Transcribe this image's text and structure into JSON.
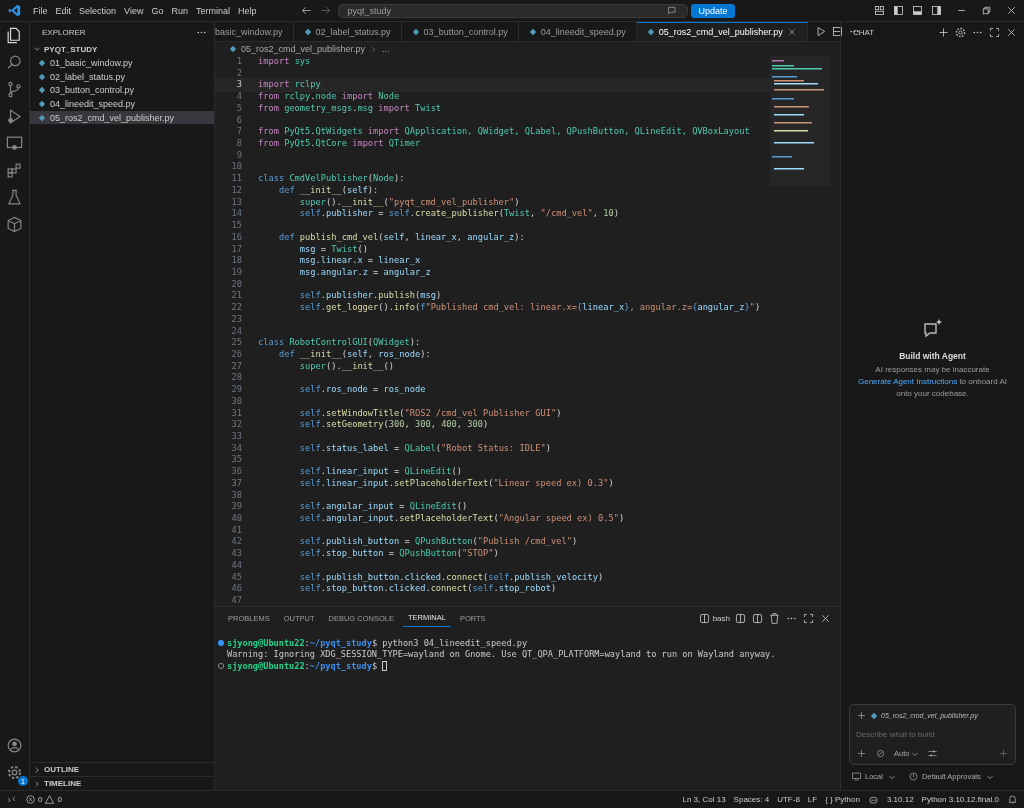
{
  "title_bar": {
    "menu": [
      "File",
      "Edit",
      "Selection",
      "View",
      "Go",
      "Run",
      "Terminal",
      "Help"
    ],
    "search": "pyqt_study",
    "update_button": "Update"
  },
  "activity_bar": {
    "badge": "1"
  },
  "explorer": {
    "title": "EXPLORER",
    "folder": {
      "name": "PYQT_STUDY",
      "expanded": true,
      "files": [
        {
          "name": "01_basic_window.py",
          "selected": false
        },
        {
          "name": "02_label_status.py",
          "selected": false
        },
        {
          "name": "03_button_control.py",
          "selected": false
        },
        {
          "name": "04_lineedit_speed.py",
          "selected": false
        },
        {
          "name": "05_ros2_cmd_vel_publisher.py",
          "selected": true
        }
      ]
    },
    "sections": [
      {
        "name": "OUTLINE",
        "expanded": false
      },
      {
        "name": "TIMELINE",
        "expanded": false
      }
    ]
  },
  "tabs": [
    {
      "label": "basic_window.py",
      "selected": false,
      "kind": "cut"
    },
    {
      "label": "02_label_status.py",
      "selected": false,
      "kind": "file"
    },
    {
      "label": "03_button_control.py",
      "selected": false,
      "kind": "file"
    },
    {
      "label": "04_lineedit_speed.py",
      "selected": false,
      "kind": "file"
    },
    {
      "label": "05_ros2_cmd_vel_publisher.py",
      "selected": true,
      "kind": "file"
    }
  ],
  "breadcrumb": {
    "file": "05_ros2_cmd_vel_publisher.py",
    "more": "..."
  },
  "editor": {
    "lines": [
      {
        "no": "1",
        "current": false,
        "tokens": [
          {
            "text": "import ",
            "kind": "keyword"
          },
          {
            "text": "sys",
            "kind": "type"
          }
        ]
      },
      {
        "no": "2",
        "current": false
      },
      {
        "no": "3",
        "current": true,
        "tokens": [
          {
            "text": "import ",
            "kind": "keyword"
          },
          {
            "text": "rclpy",
            "kind": "type"
          }
        ]
      },
      {
        "no": "4",
        "current": false,
        "tokens": [
          {
            "text": "from ",
            "kind": "keyword"
          },
          {
            "text": "rclpy",
            "kind": "type"
          },
          {
            "text": ".",
            "kind": "punct"
          },
          {
            "text": "node",
            "kind": "type"
          },
          {
            "text": " import ",
            "kind": "keyword"
          },
          {
            "text": "Node",
            "kind": "type"
          }
        ]
      },
      {
        "no": "5",
        "current": false,
        "tokens": [
          {
            "text": "from ",
            "kind": "keyword"
          },
          {
            "text": "geometry_msgs",
            "kind": "type"
          },
          {
            "text": ".",
            "kind": "punct"
          },
          {
            "text": "msg",
            "kind": "type"
          },
          {
            "text": " import ",
            "kind": "keyword"
          },
          {
            "text": "Twist",
            "kind": "type"
          }
        ]
      },
      {
        "no": "6",
        "current": false
      },
      {
        "no": "7",
        "current": false,
        "tokens": [
          {
            "text": "from ",
            "kind": "keyword"
          },
          {
            "text": "PyQt5",
            "kind": "type"
          },
          {
            "text": ".",
            "kind": "punct"
          },
          {
            "text": "QtWidgets",
            "kind": "type"
          },
          {
            "text": " import ",
            "kind": "keyword"
          },
          {
            "text": "QApplication, QWidget, QLabel, QPushButton, QLineEdit, QVBoxLayout",
            "kind": "type"
          }
        ]
      },
      {
        "no": "8",
        "current": false,
        "tokens": [
          {
            "text": "from ",
            "kind": "keyword"
          },
          {
            "text": "PyQt5",
            "kind": "type"
          },
          {
            "text": ".",
            "kind": "punct"
          },
          {
            "text": "QtCore",
            "kind": "type"
          },
          {
            "text": " import ",
            "kind": "keyword"
          },
          {
            "text": "QTimer",
            "kind": "type"
          }
        ]
      },
      {
        "no": "9",
        "current": false
      },
      {
        "no": "10",
        "current": false
      },
      {
        "no": "11",
        "current": false,
        "tokens": [
          {
            "text": "class ",
            "kind": "storage"
          },
          {
            "text": "CmdVelPublisher",
            "kind": "type"
          },
          {
            "text": "(",
            "kind": "punct"
          },
          {
            "text": "Node",
            "kind": "type"
          },
          {
            "text": "):",
            "kind": "punct"
          }
        ]
      },
      {
        "no": "12",
        "current": false,
        "tokens": [
          {
            "text": "    def ",
            "kind": "storage"
          },
          {
            "text": "__init__",
            "kind": "function"
          },
          {
            "text": "(",
            "kind": "punct"
          },
          {
            "text": "self",
            "kind": "variable"
          },
          {
            "text": "):",
            "kind": "punct"
          }
        ]
      },
      {
        "no": "13",
        "current": false,
        "tokens": [
          {
            "text": "        super",
            "kind": "type"
          },
          {
            "text": "().",
            "kind": "punct"
          },
          {
            "text": "__init__",
            "kind": "function"
          },
          {
            "text": "(",
            "kind": "punct"
          },
          {
            "text": "\"pyqt_cmd_vel_publisher\"",
            "kind": "string"
          },
          {
            "text": ")",
            "kind": "punct"
          }
        ]
      },
      {
        "no": "14",
        "current": false,
        "tokens": [
          {
            "text": "        self",
            "kind": "storage"
          },
          {
            "text": ".",
            "kind": "punct"
          },
          {
            "text": "publisher",
            "kind": "variable"
          },
          {
            "text": " = ",
            "kind": "punct"
          },
          {
            "text": "self",
            "kind": "storage"
          },
          {
            "text": ".",
            "kind": "punct"
          },
          {
            "text": "create_publisher",
            "kind": "function"
          },
          {
            "text": "(",
            "kind": "punct"
          },
          {
            "text": "Twist",
            "kind": "type"
          },
          {
            "text": ", ",
            "kind": "punct"
          },
          {
            "text": "\"/cmd_vel\"",
            "kind": "string"
          },
          {
            "text": ", ",
            "kind": "punct"
          },
          {
            "text": "10",
            "kind": "number"
          },
          {
            "text": ")",
            "kind": "punct"
          }
        ]
      },
      {
        "no": "15",
        "current": false
      },
      {
        "no": "16",
        "current": false,
        "tokens": [
          {
            "text": "    def ",
            "kind": "storage"
          },
          {
            "text": "publish_cmd_vel",
            "kind": "function"
          },
          {
            "text": "(",
            "kind": "punct"
          },
          {
            "text": "self",
            "kind": "variable"
          },
          {
            "text": ", ",
            "kind": "punct"
          },
          {
            "text": "linear_x",
            "kind": "variable"
          },
          {
            "text": ", ",
            "kind": "punct"
          },
          {
            "text": "angular_z",
            "kind": "variable"
          },
          {
            "text": "):",
            "kind": "punct"
          }
        ]
      },
      {
        "no": "17",
        "current": false,
        "tokens": [
          {
            "text": "        msg",
            "kind": "variable"
          },
          {
            "text": " = ",
            "kind": "punct"
          },
          {
            "text": "Twist",
            "kind": "type"
          },
          {
            "text": "()",
            "kind": "punct"
          }
        ]
      },
      {
        "no": "18",
        "current": false,
        "tokens": [
          {
            "text": "        msg",
            "kind": "variable"
          },
          {
            "text": ".",
            "kind": "punct"
          },
          {
            "text": "linear",
            "kind": "variable"
          },
          {
            "text": ".",
            "kind": "punct"
          },
          {
            "text": "x",
            "kind": "variable"
          },
          {
            "text": " = ",
            "kind": "punct"
          },
          {
            "text": "linear_x",
            "kind": "variable"
          }
        ]
      },
      {
        "no": "19",
        "current": false,
        "tokens": [
          {
            "text": "        msg",
            "kind": "variable"
          },
          {
            "text": ".",
            "kind": "punct"
          },
          {
            "text": "angular",
            "kind": "variable"
          },
          {
            "text": ".",
            "kind": "punct"
          },
          {
            "text": "z",
            "kind": "variable"
          },
          {
            "text": " = ",
            "kind": "punct"
          },
          {
            "text": "angular_z",
            "kind": "variable"
          }
        ]
      },
      {
        "no": "20",
        "current": false
      },
      {
        "no": "21",
        "current": false,
        "tokens": [
          {
            "text": "        self",
            "kind": "storage"
          },
          {
            "text": ".",
            "kind": "punct"
          },
          {
            "text": "publisher",
            "kind": "variable"
          },
          {
            "text": ".",
            "kind": "punct"
          },
          {
            "text": "publish",
            "kind": "function"
          },
          {
            "text": "(",
            "kind": "punct"
          },
          {
            "text": "msg",
            "kind": "variable"
          },
          {
            "text": ")",
            "kind": "punct"
          }
        ]
      },
      {
        "no": "22",
        "current": false,
        "tokens": [
          {
            "text": "        self",
            "kind": "storage"
          },
          {
            "text": ".",
            "kind": "punct"
          },
          {
            "text": "get_logger",
            "kind": "function"
          },
          {
            "text": "().",
            "kind": "punct"
          },
          {
            "text": "info",
            "kind": "function"
          },
          {
            "text": "(",
            "kind": "punct"
          },
          {
            "text": "f",
            "kind": "storage"
          },
          {
            "text": "\"Published cmd_vel: linear.x=",
            "kind": "string"
          },
          {
            "text": "{",
            "kind": "storage"
          },
          {
            "text": "linear_x",
            "kind": "variable"
          },
          {
            "text": "}",
            "kind": "storage"
          },
          {
            "text": ", angular.z=",
            "kind": "string"
          },
          {
            "text": "{",
            "kind": "storage"
          },
          {
            "text": "angular_z",
            "kind": "variable"
          },
          {
            "text": "}",
            "kind": "storage"
          },
          {
            "text": "\"",
            "kind": "string"
          },
          {
            "text": ")",
            "kind": "punct"
          }
        ]
      },
      {
        "no": "23",
        "current": false
      },
      {
        "no": "24",
        "current": false
      },
      {
        "no": "25",
        "current": false,
        "tokens": [
          {
            "text": "class ",
            "kind": "storage"
          },
          {
            "text": "RobotControlGUI",
            "kind": "type"
          },
          {
            "text": "(",
            "kind": "punct"
          },
          {
            "text": "QWidget",
            "kind": "type"
          },
          {
            "text": "):",
            "kind": "punct"
          }
        ]
      },
      {
        "no": "26",
        "current": false,
        "tokens": [
          {
            "text": "    def ",
            "kind": "storage"
          },
          {
            "text": "__init__",
            "kind": "function"
          },
          {
            "text": "(",
            "kind": "punct"
          },
          {
            "text": "self",
            "kind": "variable"
          },
          {
            "text": ", ",
            "kind": "punct"
          },
          {
            "text": "ros_node",
            "kind": "variable"
          },
          {
            "text": "):",
            "kind": "punct"
          }
        ]
      },
      {
        "no": "27",
        "current": false,
        "tokens": [
          {
            "text": "        super",
            "kind": "type"
          },
          {
            "text": "().",
            "kind": "punct"
          },
          {
            "text": "__init__",
            "kind": "function"
          },
          {
            "text": "()",
            "kind": "punct"
          }
        ]
      },
      {
        "no": "28",
        "current": false
      },
      {
        "no": "29",
        "current": false,
        "tokens": [
          {
            "text": "        self",
            "kind": "storage"
          },
          {
            "text": ".",
            "kind": "punct"
          },
          {
            "text": "ros_node",
            "kind": "variable"
          },
          {
            "text": " = ",
            "kind": "punct"
          },
          {
            "text": "ros_node",
            "kind": "variable"
          }
        ]
      },
      {
        "no": "30",
        "current": false
      },
      {
        "no": "31",
        "current": false,
        "tokens": [
          {
            "text": "        self",
            "kind": "storage"
          },
          {
            "text": ".",
            "kind": "punct"
          },
          {
            "text": "setWindowTitle",
            "kind": "function"
          },
          {
            "text": "(",
            "kind": "punct"
          },
          {
            "text": "\"ROS2 /cmd_vel Publisher GUI\"",
            "kind": "string"
          },
          {
            "text": ")",
            "kind": "punct"
          }
        ]
      },
      {
        "no": "32",
        "current": false,
        "tokens": [
          {
            "text": "        self",
            "kind": "storage"
          },
          {
            "text": ".",
            "kind": "punct"
          },
          {
            "text": "setGeometry",
            "kind": "function"
          },
          {
            "text": "(",
            "kind": "punct"
          },
          {
            "text": "300",
            "kind": "number"
          },
          {
            "text": ", ",
            "kind": "punct"
          },
          {
            "text": "300",
            "kind": "number"
          },
          {
            "text": ", ",
            "kind": "punct"
          },
          {
            "text": "400",
            "kind": "number"
          },
          {
            "text": ", ",
            "kind": "punct"
          },
          {
            "text": "300",
            "kind": "number"
          },
          {
            "text": ")",
            "kind": "punct"
          }
        ]
      },
      {
        "no": "33",
        "current": false
      },
      {
        "no": "34",
        "current": false,
        "tokens": [
          {
            "text": "        self",
            "kind": "storage"
          },
          {
            "text": ".",
            "kind": "punct"
          },
          {
            "text": "status_label",
            "kind": "variable"
          },
          {
            "text": " = ",
            "kind": "punct"
          },
          {
            "text": "QLabel",
            "kind": "type"
          },
          {
            "text": "(",
            "kind": "punct"
          },
          {
            "text": "\"Robot Status: IDLE\"",
            "kind": "string"
          },
          {
            "text": ")",
            "kind": "punct"
          }
        ]
      },
      {
        "no": "35",
        "current": false
      },
      {
        "no": "36",
        "current": false,
        "tokens": [
          {
            "text": "        self",
            "kind": "storage"
          },
          {
            "text": ".",
            "kind": "punct"
          },
          {
            "text": "linear_input",
            "kind": "variable"
          },
          {
            "text": " = ",
            "kind": "punct"
          },
          {
            "text": "QLineEdit",
            "kind": "type"
          },
          {
            "text": "()",
            "kind": "punct"
          }
        ]
      },
      {
        "no": "37",
        "current": false,
        "tokens": [
          {
            "text": "        self",
            "kind": "storage"
          },
          {
            "text": ".",
            "kind": "punct"
          },
          {
            "text": "linear_input",
            "kind": "variable"
          },
          {
            "text": ".",
            "kind": "punct"
          },
          {
            "text": "setPlaceholderText",
            "kind": "function"
          },
          {
            "text": "(",
            "kind": "punct"
          },
          {
            "text": "\"Linear speed ex) 0.3\"",
            "kind": "string"
          },
          {
            "text": ")",
            "kind": "punct"
          }
        ]
      },
      {
        "no": "38",
        "current": false
      },
      {
        "no": "39",
        "current": false,
        "tokens": [
          {
            "text": "        self",
            "kind": "storage"
          },
          {
            "text": ".",
            "kind": "punct"
          },
          {
            "text": "angular_input",
            "kind": "variable"
          },
          {
            "text": " = ",
            "kind": "punct"
          },
          {
            "text": "QLineEdit",
            "kind": "type"
          },
          {
            "text": "()",
            "kind": "punct"
          }
        ]
      },
      {
        "no": "40",
        "current": false,
        "tokens": [
          {
            "text": "        self",
            "kind": "storage"
          },
          {
            "text": ".",
            "kind": "punct"
          },
          {
            "text": "angular_input",
            "kind": "variable"
          },
          {
            "text": ".",
            "kind": "punct"
          },
          {
            "text": "setPlaceholderText",
            "kind": "function"
          },
          {
            "text": "(",
            "kind": "punct"
          },
          {
            "text": "\"Angular speed ex) 0.5\"",
            "kind": "string"
          },
          {
            "text": ")",
            "kind": "punct"
          }
        ]
      },
      {
        "no": "41",
        "current": false
      },
      {
        "no": "42",
        "current": false,
        "tokens": [
          {
            "text": "        self",
            "kind": "storage"
          },
          {
            "text": ".",
            "kind": "punct"
          },
          {
            "text": "publish_button",
            "kind": "variable"
          },
          {
            "text": " = ",
            "kind": "punct"
          },
          {
            "text": "QPushButton",
            "kind": "type"
          },
          {
            "text": "(",
            "kind": "punct"
          },
          {
            "text": "\"Publish /cmd_vel\"",
            "kind": "string"
          },
          {
            "text": ")",
            "kind": "punct"
          }
        ]
      },
      {
        "no": "43",
        "current": false,
        "tokens": [
          {
            "text": "        self",
            "kind": "storage"
          },
          {
            "text": ".",
            "kind": "punct"
          },
          {
            "text": "stop_button",
            "kind": "variable"
          },
          {
            "text": " = ",
            "kind": "punct"
          },
          {
            "text": "QPushButton",
            "kind": "type"
          },
          {
            "text": "(",
            "kind": "punct"
          },
          {
            "text": "\"STOP\"",
            "kind": "string"
          },
          {
            "text": ")",
            "kind": "punct"
          }
        ]
      },
      {
        "no": "44",
        "current": false
      },
      {
        "no": "45",
        "current": false,
        "tokens": [
          {
            "text": "        self",
            "kind": "storage"
          },
          {
            "text": ".",
            "kind": "punct"
          },
          {
            "text": "publish_button",
            "kind": "variable"
          },
          {
            "text": ".",
            "kind": "punct"
          },
          {
            "text": "clicked",
            "kind": "variable"
          },
          {
            "text": ".",
            "kind": "punct"
          },
          {
            "text": "connect",
            "kind": "function"
          },
          {
            "text": "(",
            "kind": "punct"
          },
          {
            "text": "self",
            "kind": "storage"
          },
          {
            "text": ".",
            "kind": "punct"
          },
          {
            "text": "publish_velocity",
            "kind": "variable"
          },
          {
            "text": ")",
            "kind": "punct"
          }
        ]
      },
      {
        "no": "46",
        "current": false,
        "tokens": [
          {
            "text": "        self",
            "kind": "storage"
          },
          {
            "text": ".",
            "kind": "punct"
          },
          {
            "text": "stop_button",
            "kind": "variable"
          },
          {
            "text": ".",
            "kind": "punct"
          },
          {
            "text": "clicked",
            "kind": "variable"
          },
          {
            "text": ".",
            "kind": "punct"
          },
          {
            "text": "connect",
            "kind": "function"
          },
          {
            "text": "(",
            "kind": "punct"
          },
          {
            "text": "self",
            "kind": "storage"
          },
          {
            "text": ".",
            "kind": "punct"
          },
          {
            "text": "stop_robot",
            "kind": "variable"
          },
          {
            "text": ")",
            "kind": "punct"
          }
        ]
      },
      {
        "no": "47",
        "current": false
      }
    ]
  },
  "panel": {
    "tabs": [
      {
        "label": "PROBLEMS",
        "selected": false
      },
      {
        "label": "OUTPUT",
        "selected": false
      },
      {
        "label": "DEBUG CONSOLE",
        "selected": false
      },
      {
        "label": "TERMINAL",
        "selected": true
      },
      {
        "label": "PORTS",
        "selected": false
      }
    ],
    "shell": "bash",
    "lines": [
      {
        "kind": "success",
        "cursor": false,
        "tokens": [
          {
            "text": "sjyong@Ubuntu22",
            "kind": "user"
          },
          {
            "text": ":",
            "kind": "plain"
          },
          {
            "text": "~/pyqt_study",
            "kind": "path"
          },
          {
            "text": "$ python3 04_lineedit_speed.py",
            "kind": "plain"
          }
        ]
      },
      {
        "kind": "output",
        "cursor": false,
        "tokens": [
          {
            "text": "Warning: Ignoring XDG_SESSION_TYPE=wayland on Gnome. Use QT_QPA_PLATFORM=wayland to run on Wayland anyway.",
            "kind": "plain"
          }
        ]
      },
      {
        "kind": "pending",
        "cursor": true,
        "tokens": [
          {
            "text": "sjyong@Ubuntu22",
            "kind": "user"
          },
          {
            "text": ":",
            "kind": "plain"
          },
          {
            "text": "~/pyqt_study",
            "kind": "path"
          },
          {
            "text": "$",
            "kind": "plain"
          }
        ]
      }
    ]
  },
  "chat": {
    "title": "CHAT",
    "heading": "Build with Agent",
    "note": "AI responses may be inaccurate",
    "link": "Generate Agent Instructions",
    "rest": " to onboard AI onto your codebase.",
    "context_file": "05_ros2_cmd_vel_publisher.py",
    "placeholder": "Describe what to build",
    "mode": "Auto",
    "target": "Local",
    "approvals": "Default Approvals"
  },
  "status_bar": {
    "errors": "0",
    "warnings": "0",
    "items": [
      "Ln 3, Col 13",
      "Spaces: 4",
      "UTF-8",
      "LF",
      "{ } Python"
    ],
    "version": "3.10.12",
    "interpreter": "Python 3.10.12.final.0"
  }
}
